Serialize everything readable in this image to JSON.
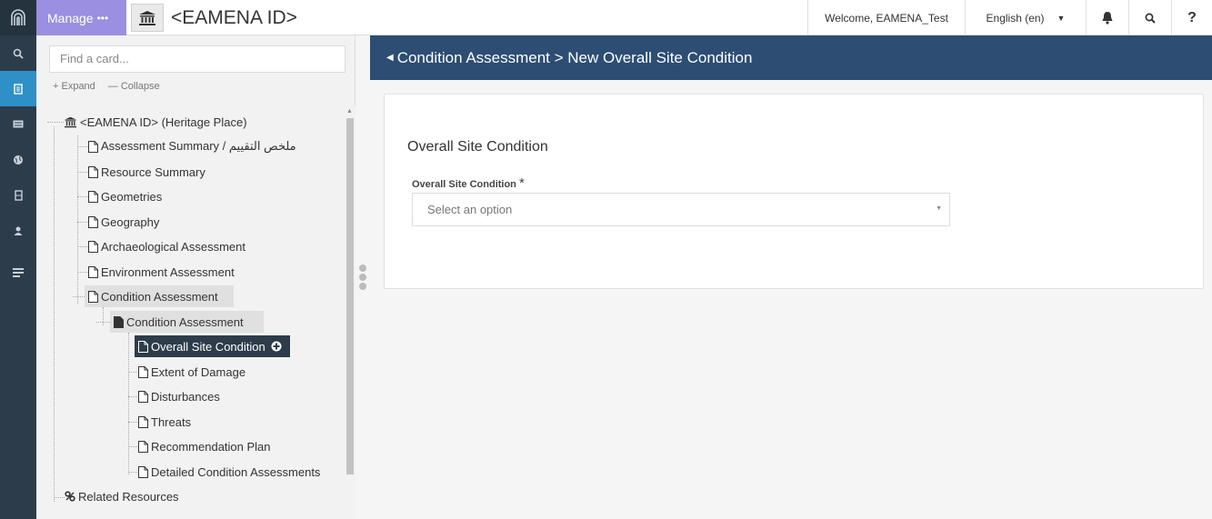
{
  "header": {
    "manage_label": "Manage",
    "manage_dots": "•••",
    "resource_title": "<EAMENA ID>",
    "welcome_text": "Welcome, EAMENA_Test",
    "language": "English (en)",
    "icons": [
      "bell-icon",
      "search-icon",
      "help-icon"
    ],
    "help_label": "?"
  },
  "rail": {
    "items": [
      "search-icon",
      "resource-icon",
      "card-icon",
      "globe-icon",
      "book-icon",
      "user-icon",
      "list-icon"
    ]
  },
  "sidebar": {
    "search_placeholder": "Find a card...",
    "expand_label": "Expand",
    "collapse_label": "Collapse",
    "tree": [
      {
        "label": "<EAMENA ID> (Heritage Place)"
      },
      {
        "label": "Assessment Summary / ملخص التقييم"
      },
      {
        "label": "Resource Summary"
      },
      {
        "label": "Geometries"
      },
      {
        "label": "Geography"
      },
      {
        "label": "Archaeological Assessment"
      },
      {
        "label": "Environment Assessment"
      },
      {
        "label": "Condition Assessment"
      },
      {
        "label": "Condition Assessment"
      },
      {
        "label": "Overall Site Condition"
      },
      {
        "label": "Extent of Damage"
      },
      {
        "label": "Disturbances"
      },
      {
        "label": "Threats"
      },
      {
        "label": "Recommendation Plan"
      },
      {
        "label": "Detailed Condition Assessments"
      },
      {
        "label": "Related Resources"
      }
    ]
  },
  "main": {
    "breadcrumb": "Condition Assessment > New Overall Site Condition",
    "card_title": "Overall Site Condition",
    "field_label": "Overall Site Condition",
    "required_mark": "*",
    "select_placeholder": "Select an option"
  },
  "colors": {
    "rail": "#2d3c4b",
    "rail_active": "#2f8fc7",
    "manage": "#9a8fe0",
    "main_header": "#2d4d73",
    "selected_node": "#2d3c4b"
  }
}
